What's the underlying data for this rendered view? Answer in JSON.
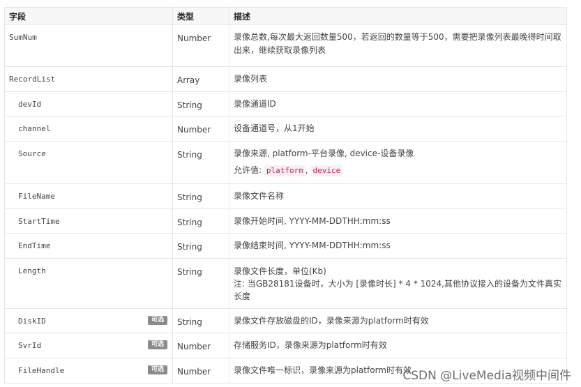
{
  "header": {
    "field": "字段",
    "type": "类型",
    "desc": "描述"
  },
  "rows": [
    {
      "field": "SumNum",
      "type": "Number",
      "desc": "录像总数,每次最大返回数量500，若返回的数量等于500，需要把录像列表最晚得时间取出来，继续获取录像列表"
    },
    {
      "field": "RecordList",
      "type": "Array",
      "desc": "录像列表"
    },
    {
      "field": "devId",
      "type": "String",
      "desc": "录像通道ID"
    },
    {
      "field": "channel",
      "type": "Number",
      "desc": "设备通道号，从1开始"
    },
    {
      "field": "Source",
      "type": "String",
      "desc": "录像来源, platform-平台录像, device-设备录像",
      "allowed_label": "允许值:",
      "allowed_values": [
        "platform",
        "device"
      ],
      "separator": ","
    },
    {
      "field": "FileName",
      "type": "String",
      "desc": "录像文件名称"
    },
    {
      "field": "StartTime",
      "type": "String",
      "desc": "录像开始时间, YYYY-MM-DDTHH:mm:ss"
    },
    {
      "field": "EndTime",
      "type": "String",
      "desc": "录像结束时间, YYYY-MM-DDTHH:mm:ss"
    },
    {
      "field": "Length",
      "type": "String",
      "desc": "录像文件长度，单位(Kb)",
      "desc_note": "注: 当GB28181设备时，大小为 [录像时长] * 4 * 1024,其他协议接入的设备为文件真实长度"
    },
    {
      "field": "DiskID",
      "type": "String",
      "desc": "录像文件存放磁盘的ID，录像来源为platform时有效",
      "badge": "可选"
    },
    {
      "field": "SvrId",
      "type": "Number",
      "desc": "存储服务ID，录像来源为platform时有效",
      "badge": "可选"
    },
    {
      "field": "FileHandle",
      "type": "Number",
      "desc": "录像文件唯一标识，录像来源为platform时有效",
      "badge": "可选"
    }
  ],
  "watermark": "CSDN @LiveMedia视频中间件"
}
